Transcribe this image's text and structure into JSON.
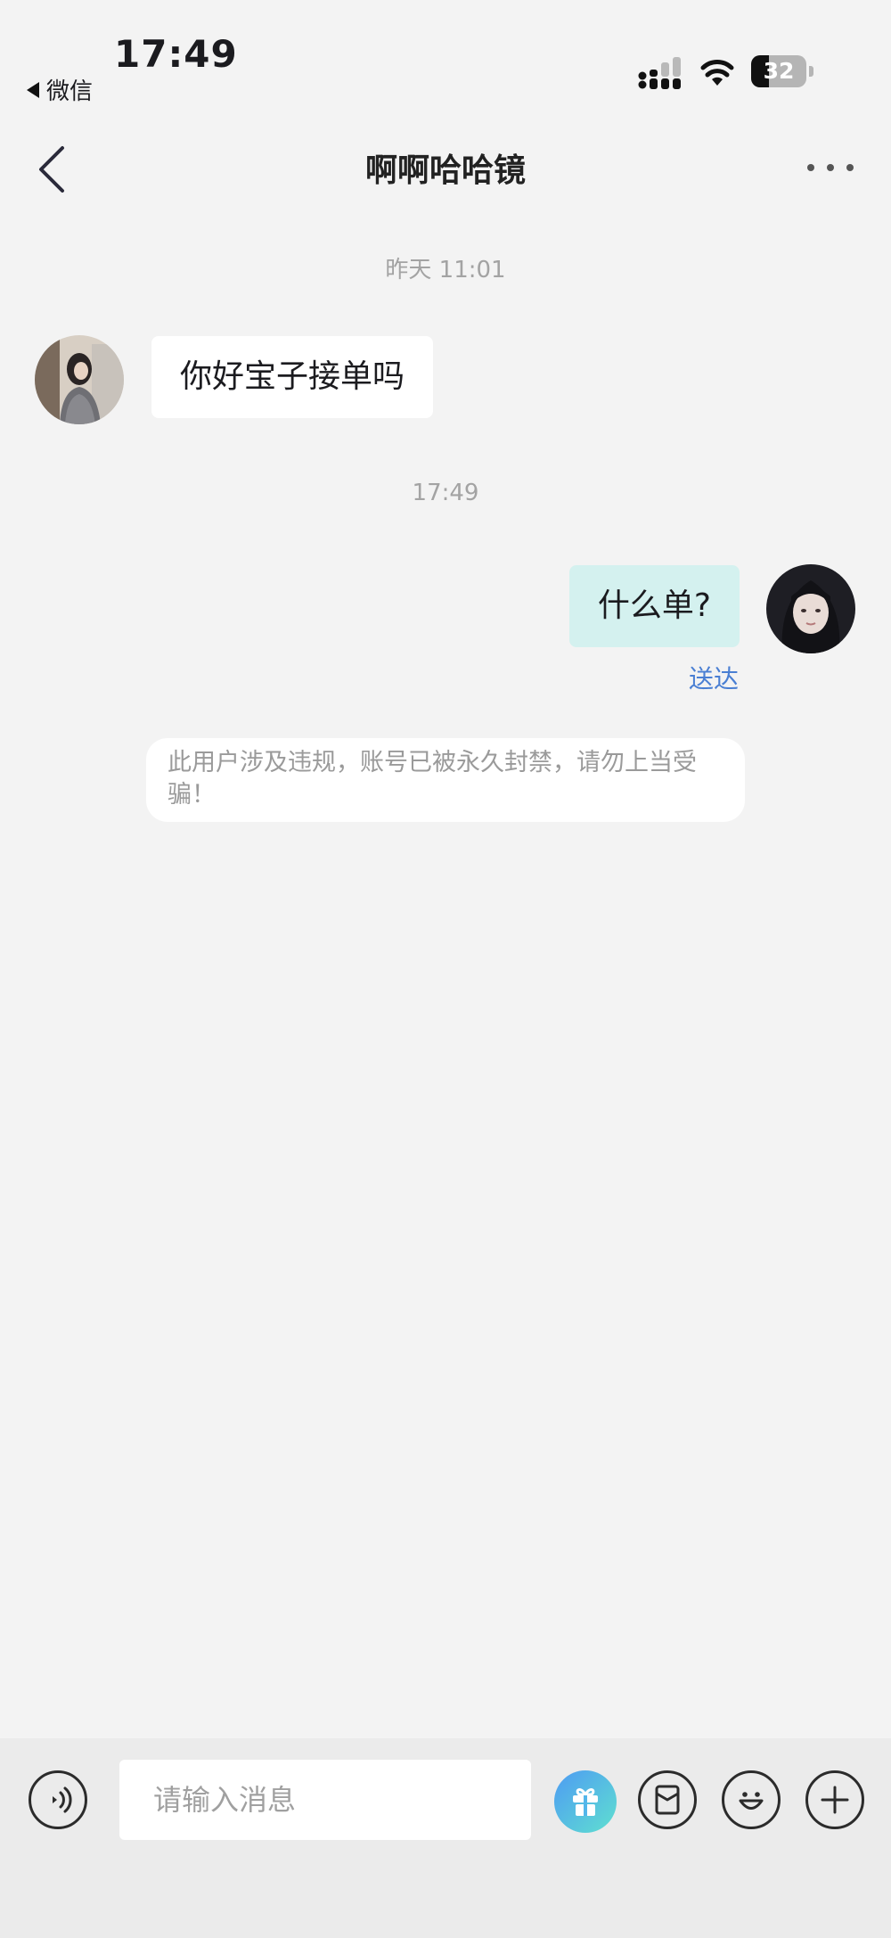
{
  "status_bar": {
    "time": "17:49",
    "back_app_label": "微信",
    "battery_level": "32"
  },
  "nav": {
    "title": "啊啊哈哈镜",
    "back_icon": "chevron-left-icon",
    "more_icon": "ellipsis-icon"
  },
  "messages": {
    "timestamp_1": "昨天 11:01",
    "incoming_text": "你好宝子接单吗",
    "timestamp_2": "17:49",
    "outgoing_text": "什么单?",
    "outgoing_status": "送达",
    "system_notice": "此用户涉及违规，账号已被永久封禁，请勿上当受骗！"
  },
  "composer": {
    "placeholder": "请输入消息",
    "icons": [
      "voice-icon",
      "gift-icon",
      "red-packet-icon",
      "emoji-icon",
      "plus-icon"
    ]
  },
  "colors": {
    "background": "#f3f3f3",
    "outgoing_bubble": "#d4f1ef",
    "read_status": "#4a7fd3",
    "gift_gradient_start": "#4e9bf3",
    "gift_gradient_end": "#5fe0d0"
  }
}
